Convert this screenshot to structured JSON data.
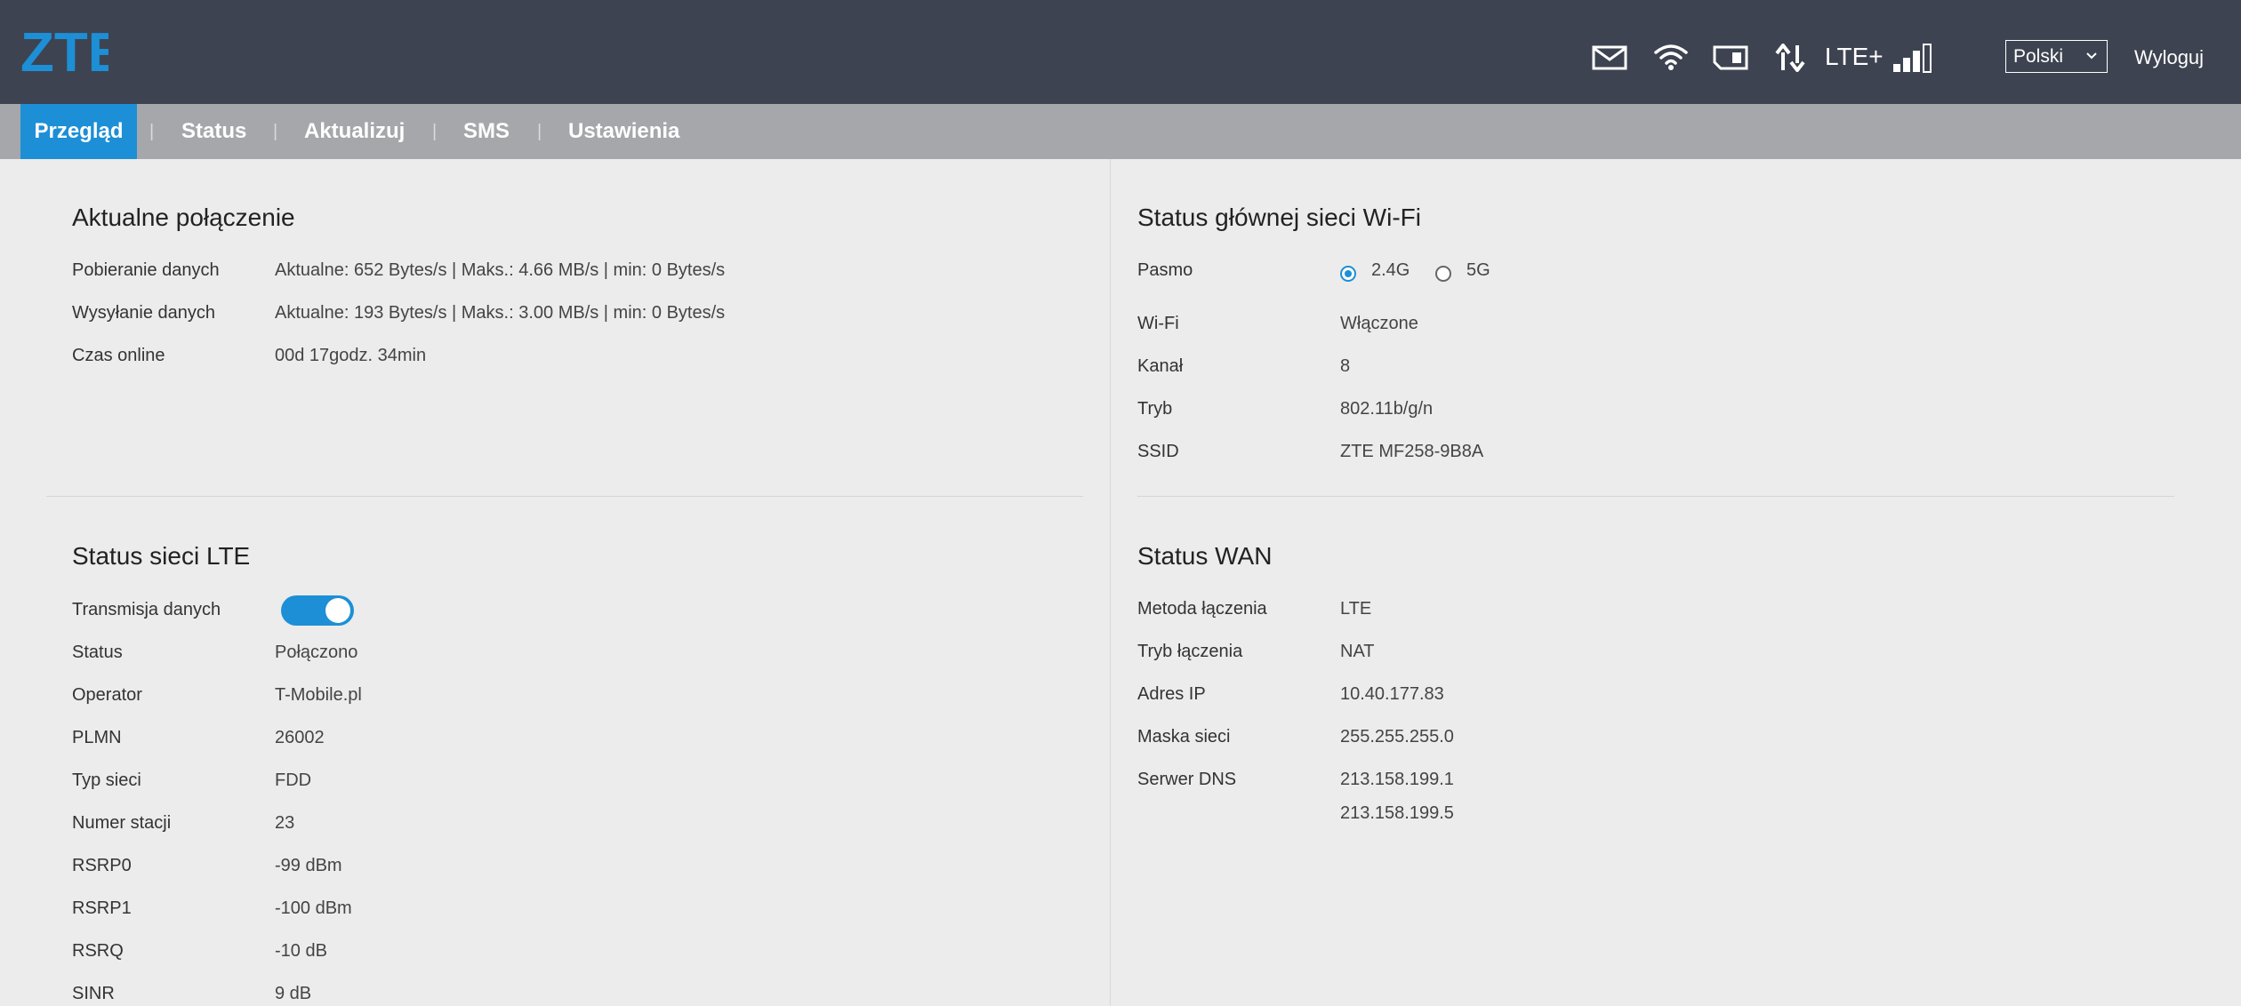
{
  "header": {
    "logo_text": "ZTE",
    "network_type": "LTE+",
    "signal_bars": 3,
    "language": "Polski",
    "logout_label": "Wyloguj",
    "icons": [
      "envelope-icon",
      "wifi-icon",
      "sim-card-icon",
      "data-transfer-icon",
      "signal-icon"
    ]
  },
  "nav": {
    "tabs": [
      "Przegląd",
      "Status",
      "Aktualizuj",
      "SMS",
      "Ustawienia"
    ],
    "active": "Przegląd",
    "separator": "|"
  },
  "current_connection": {
    "title": "Aktualne połączenie",
    "rows": [
      {
        "label": "Pobieranie danych",
        "value": "Aktualne: 652 Bytes/s | Maks.: 4.66 MB/s | min: 0 Bytes/s"
      },
      {
        "label": "Wysyłanie danych",
        "value": "Aktualne: 193 Bytes/s | Maks.: 3.00 MB/s | min: 0 Bytes/s"
      },
      {
        "label": "Czas online",
        "value": "00d 17godz. 34min"
      }
    ]
  },
  "wifi_status": {
    "title": "Status głównej sieci Wi-Fi",
    "band_label": "Pasmo",
    "band_options": [
      "2.4G",
      "5G"
    ],
    "band_selected": "2.4G",
    "rows": [
      {
        "label": "Wi-Fi",
        "value": "Włączone"
      },
      {
        "label": "Kanał",
        "value": "8"
      },
      {
        "label": "Tryb",
        "value": "802.11b/g/n"
      },
      {
        "label": "SSID",
        "value": "ZTE MF258-9B8A"
      }
    ]
  },
  "lte_status": {
    "title": "Status sieci LTE",
    "data_transmission_label": "Transmisja danych",
    "data_transmission_on": true,
    "rows": [
      {
        "label": "Status",
        "value": "Połączono"
      },
      {
        "label": "Operator",
        "value": "T-Mobile.pl"
      },
      {
        "label": "PLMN",
        "value": "26002"
      },
      {
        "label": "Typ sieci",
        "value": "FDD"
      },
      {
        "label": "Numer stacji",
        "value": "23"
      },
      {
        "label": "RSRP0",
        "value": "-99 dBm"
      },
      {
        "label": "RSRP1",
        "value": "-100 dBm"
      },
      {
        "label": "RSRQ",
        "value": "-10 dB"
      },
      {
        "label": "SINR",
        "value": "9 dB"
      }
    ]
  },
  "wan_status": {
    "title": "Status WAN",
    "rows": [
      {
        "label": "Metoda łączenia",
        "value": "LTE"
      },
      {
        "label": "Tryb łączenia",
        "value": "NAT"
      },
      {
        "label": "Adres IP",
        "value": "10.40.177.83"
      },
      {
        "label": "Maska sieci",
        "value": "255.255.255.0"
      },
      {
        "label": "Serwer DNS",
        "value": "213.158.199.1"
      }
    ],
    "dns_secondary": "213.158.199.5"
  },
  "colors": {
    "header_bg": "#3d4350",
    "nav_bg": "#a5a7ab",
    "accent": "#1d8fd6",
    "content_bg": "#ececec"
  }
}
